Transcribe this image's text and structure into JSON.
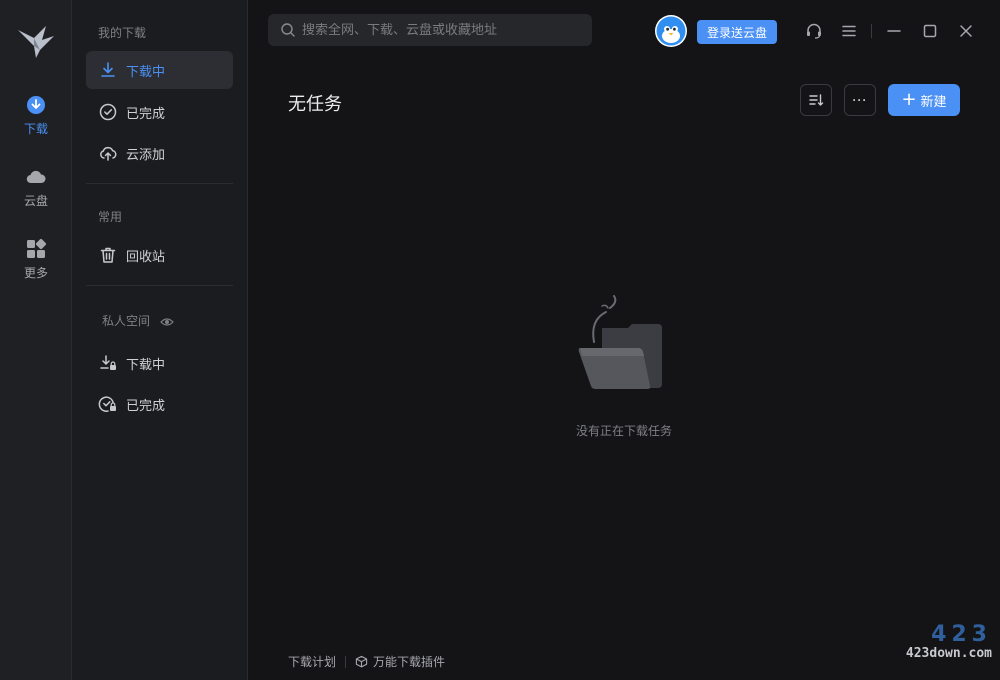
{
  "rail": {
    "items": [
      {
        "label": "下载"
      },
      {
        "label": "云盘"
      },
      {
        "label": "更多"
      }
    ]
  },
  "sidebar": {
    "section_downloads": "我的下载",
    "downloading": "下载中",
    "completed": "已完成",
    "cloud_add": "云添加",
    "section_common": "常用",
    "recycle_bin": "回收站",
    "section_private": "私人空间",
    "private_downloading": "下载中",
    "private_completed": "已完成"
  },
  "search": {
    "placeholder": "搜索全网、下载、云盘或收藏地址",
    "value": ""
  },
  "topbar": {
    "login_label": "登录送云盘"
  },
  "main": {
    "title": "无任务",
    "new_label": "新建",
    "more_label": "···",
    "empty_text": "没有正在下载任务"
  },
  "footer": {
    "plan": "下载计划",
    "plugin": "万能下载插件"
  },
  "watermark": {
    "number": "423",
    "site": "423down.com"
  },
  "colors": {
    "accent": "#4a90f5",
    "background": "#141416",
    "sidebar": "#1b1c1f",
    "rail": "#1f2023"
  }
}
